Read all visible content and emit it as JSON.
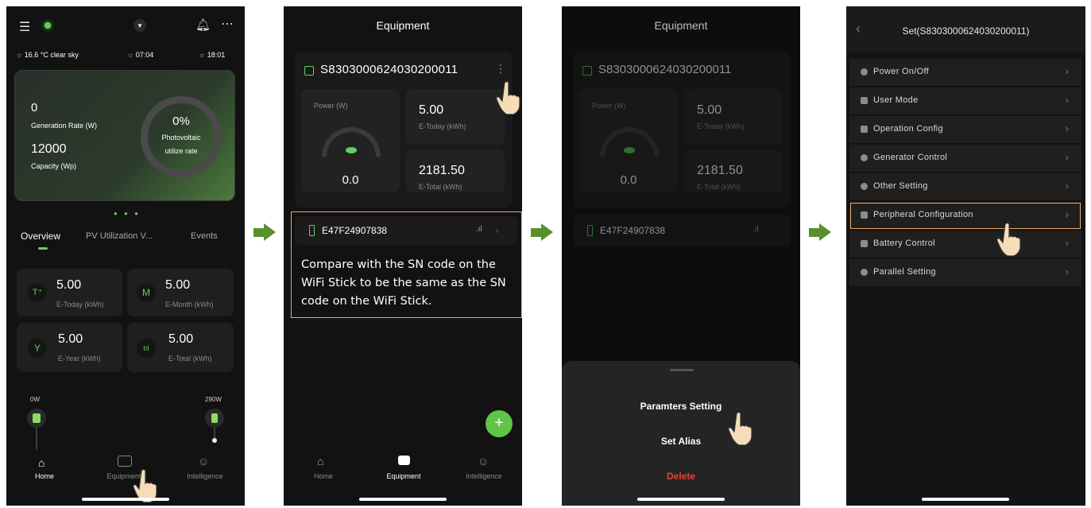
{
  "screen1": {
    "weather": "16.6 °C clear sky",
    "sunrise": "07:04",
    "sunset": "18:01",
    "generation_rate_value": "0",
    "generation_rate_label": "Generation Rate (W)",
    "capacity_value": "12000",
    "capacity_label": "Capacity (Wp)",
    "pv_percent": "0%",
    "pv_label_1": "Photovoltaic",
    "pv_label_2": "utilize rate",
    "tabs": [
      "Overview",
      "PV Utilization V...",
      "Events"
    ],
    "stats": [
      {
        "value": "5.00",
        "label": "E-Today (kWh)",
        "icon": "T⁺"
      },
      {
        "value": "5.00",
        "label": "E-Month (kWh)",
        "icon": "M"
      },
      {
        "value": "5.00",
        "label": "E-Year (kWh)",
        "icon": "Y"
      },
      {
        "value": "5.00",
        "label": "E-Total (kWh)",
        "icon": "tıl"
      }
    ],
    "flow_left": "0W",
    "flow_right": "290W",
    "nav": [
      "Home",
      "Equipment",
      "Intelligence"
    ]
  },
  "screen2": {
    "title": "Equipment",
    "sn": "S830300062403020001​1",
    "power_label": "Power (W)",
    "power_value": "0.0",
    "e_today_value": "5.00",
    "e_today_label": "E-Today (kWh)",
    "e_total_value": "2181.50",
    "e_total_label": "E-Total (kWh)",
    "stick_sn": "E47F24907838",
    "note": "Compare with the SN code on the WiFi Stick to be the same as the SN code on the WiFi Stick.",
    "fab": "+",
    "nav": [
      "Home",
      "Equipment",
      "Intelligence"
    ]
  },
  "screen3": {
    "title": "Equipment",
    "sn": "S830300062403020001​1",
    "power_label": "Power (W)",
    "power_value": "0.0",
    "e_today_value": "5.00",
    "e_today_label": "E-Today (kWh)",
    "e_total_value": "2181.50",
    "e_total_label": "E-Total (kWh)",
    "stick_sn": "E47F24907838",
    "sheet_items": [
      "Paramters Setting",
      "Set Alias",
      "Delete"
    ]
  },
  "screen4": {
    "title": "Set(S830300062403020001​1)",
    "menu": [
      "Power On/Off",
      "User Mode",
      "Operation Config",
      "Generator Control",
      "Other Setting",
      "Peripheral Configuration",
      "Battery Control",
      "Parallel Setting"
    ]
  },
  "colors": {
    "accent": "#5fd35f",
    "highlight": "#f0a868",
    "arrow": "#5a8f2e",
    "delete": "#e0443a"
  }
}
